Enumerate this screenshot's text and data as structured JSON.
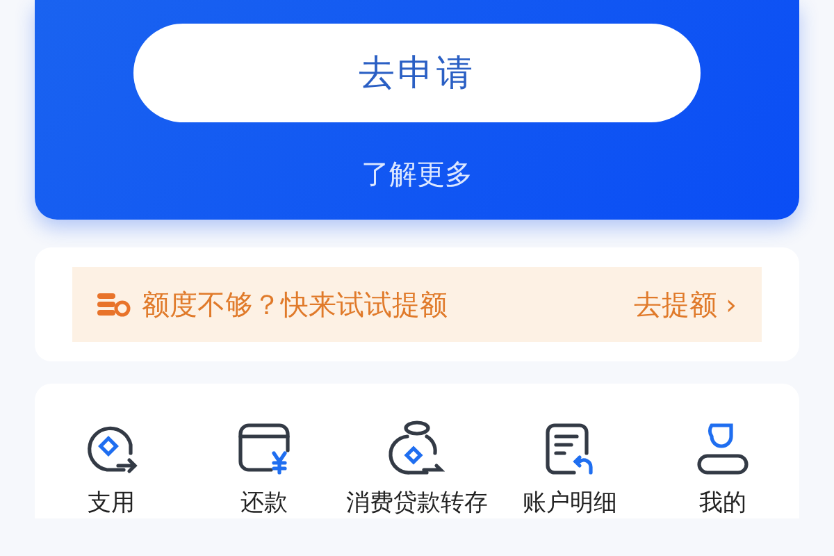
{
  "hero": {
    "apply_button": "去申请",
    "learn_more": "了解更多"
  },
  "banner": {
    "text": "额度不够？快来试试提额",
    "action": "去提额",
    "chevron": "›"
  },
  "shortcuts": [
    {
      "kind": "withdraw",
      "label": "支用"
    },
    {
      "kind": "repay",
      "label": "还款"
    },
    {
      "kind": "transfer",
      "label": "消费贷款转存"
    },
    {
      "kind": "statement",
      "label": "账户明细"
    },
    {
      "kind": "profile",
      "label": "我的"
    }
  ]
}
